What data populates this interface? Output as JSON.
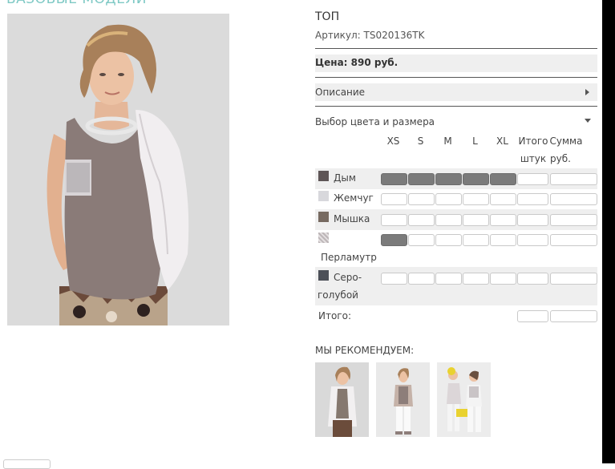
{
  "section": {
    "title": "БАЗОВЫЕ МОДЕЛИ"
  },
  "product": {
    "name": "ТОП",
    "article": "Артикул: TS020136TK",
    "price": "Цена: 890 руб.",
    "description_label": "Описание",
    "select_label": "Выбор цвета и размера"
  },
  "table": {
    "sizes": [
      "XS",
      "S",
      "M",
      "L",
      "XL"
    ],
    "total_pcs_header": [
      "Итого",
      "штук"
    ],
    "sum_header": [
      "Сумма",
      "руб."
    ],
    "colors": [
      {
        "name": "Дым",
        "swatch": "#5e5556",
        "filled": [
          true,
          true,
          true,
          true,
          true
        ]
      },
      {
        "name": "Жемчуг",
        "swatch": "#d8d8dc",
        "filled": [
          false,
          false,
          false,
          false,
          false
        ]
      },
      {
        "name": "Мышка",
        "swatch": "#776a61",
        "filled": [
          false,
          false,
          false,
          false,
          false
        ]
      },
      {
        "name": "Перламутр",
        "swatch": "#c9c3c5",
        "filled": [
          true,
          false,
          false,
          false,
          false
        ]
      },
      {
        "name_lines": [
          "Серо-",
          "голубой"
        ],
        "swatch": "#4c5058",
        "filled": [
          false,
          false,
          false,
          false,
          false
        ]
      }
    ],
    "total_label": "Итого:"
  },
  "recommend": {
    "title": "МЫ РЕКОМЕНДУЕМ:"
  },
  "colors": {
    "accent": "#7fc9c5",
    "row_bg": "#efefef",
    "filled_cell": "#7b7b7b"
  }
}
